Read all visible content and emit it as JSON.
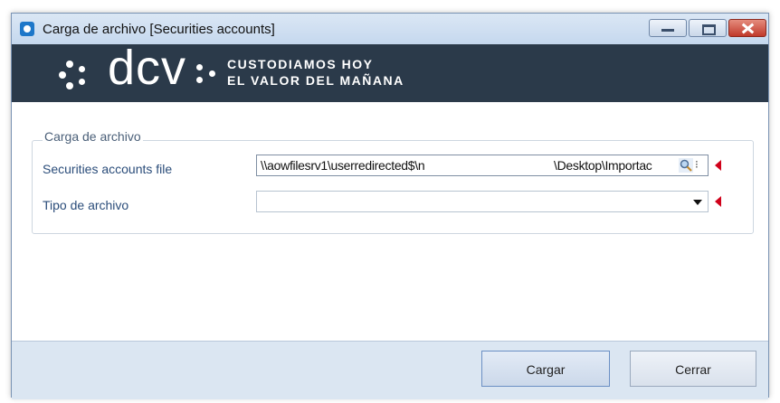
{
  "window": {
    "title": "Carga de archivo [Securities accounts]"
  },
  "banner": {
    "logo_text": "dcv",
    "tagline_line1": "CUSTODIAMOS HOY",
    "tagline_line2": "EL VALOR DEL MAÑANA"
  },
  "form": {
    "group_title": "Carga de archivo",
    "file_label": "Securities accounts file",
    "file_value_left": "\\\\aowfilesrv1\\userredirected$\\n",
    "file_value_right": "\\Desktop\\Importac",
    "type_label": "Tipo de archivo",
    "type_value": ""
  },
  "buttons": {
    "load_label": "Cargar",
    "close_label": "Cerrar"
  },
  "colors": {
    "banner_bg": "#2b3a4a",
    "required_marker": "#d0021b",
    "label_text": "#2b4d7a"
  }
}
